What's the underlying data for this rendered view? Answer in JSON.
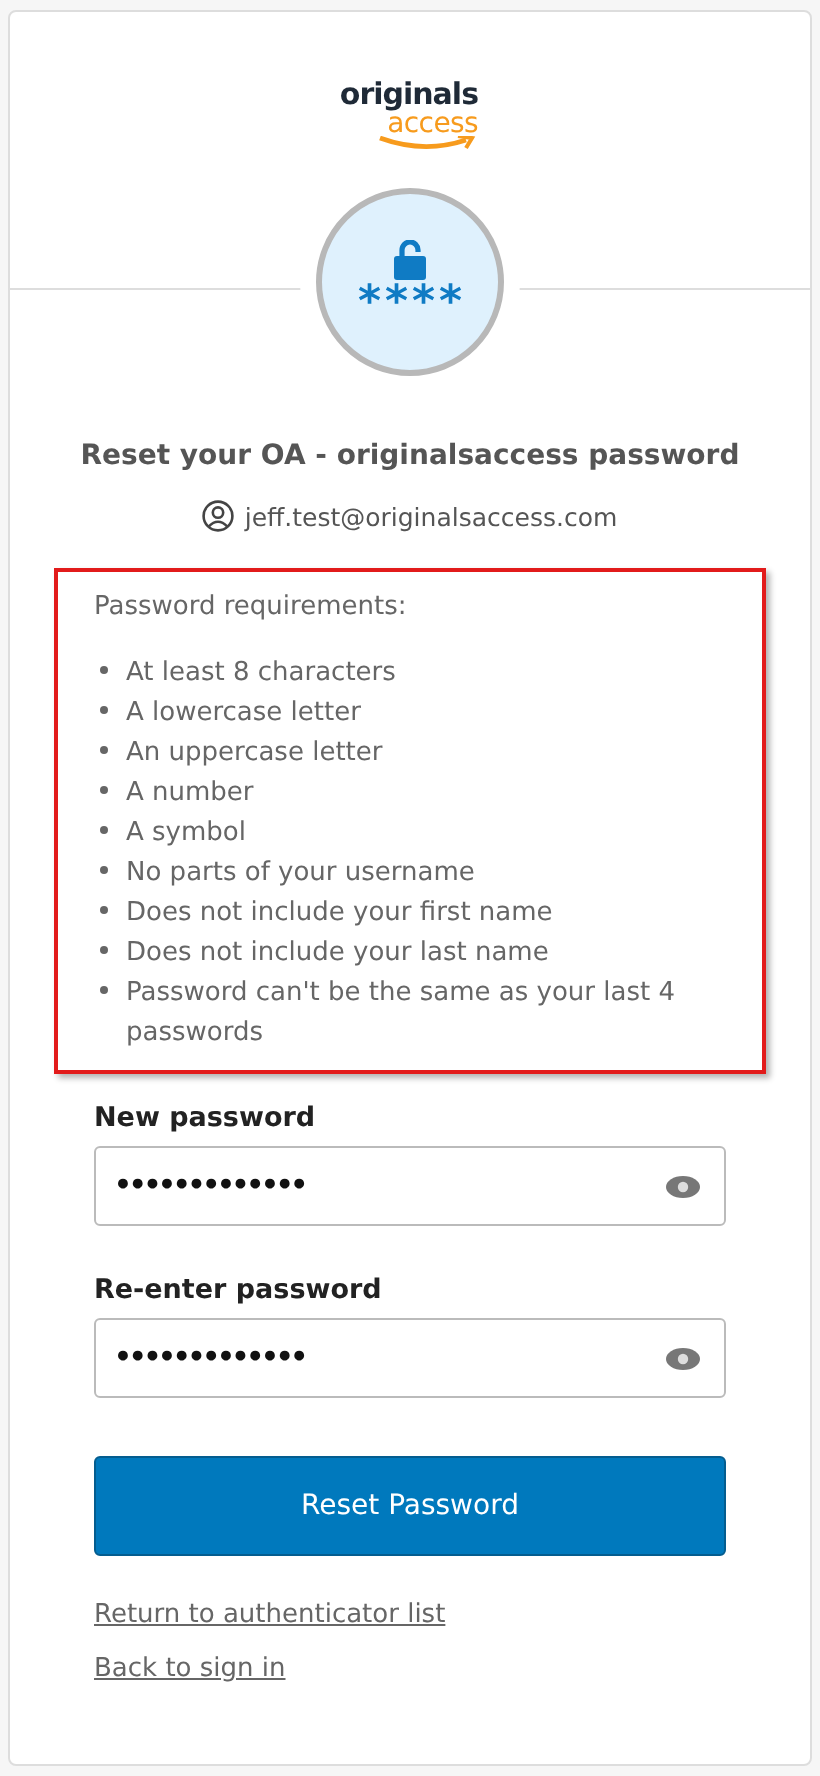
{
  "logo": {
    "line_1": "originals",
    "line_2": "access"
  },
  "badge": {
    "text": "****"
  },
  "title": "Reset your OA - originalsaccess password",
  "account": "jeff.test@originalsaccess.com",
  "requirements": {
    "heading": "Password requirements:",
    "highlighted": true,
    "items": [
      "At least 8 characters",
      "A lowercase letter",
      "An uppercase letter",
      "A number",
      "A symbol",
      "No parts of your username",
      "Does not include your first name",
      "Does not include your last name",
      "Password can't be the same as your last 4 passwords"
    ]
  },
  "fields": [
    {
      "label": "New password",
      "value": "•••••••••••••"
    },
    {
      "label": "Re-enter password",
      "value": "•••••••••••••"
    }
  ],
  "submit": "Reset Password",
  "links": [
    "Return to authenticator list",
    "Back to sign in"
  ]
}
